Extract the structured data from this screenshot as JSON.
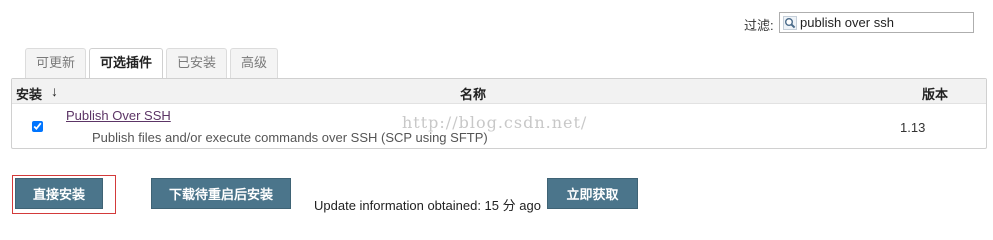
{
  "filter": {
    "label": "过滤:",
    "value": "publish over ssh"
  },
  "tabs": [
    {
      "label": "可更新",
      "active": false
    },
    {
      "label": "可选插件",
      "active": true
    },
    {
      "label": "已安装",
      "active": false
    },
    {
      "label": "高级",
      "active": false
    }
  ],
  "table": {
    "headers": {
      "install": "安装",
      "sort_indicator": "↓",
      "name": "名称",
      "version": "版本"
    },
    "rows": [
      {
        "checked": true,
        "name": "Publish Over SSH",
        "description": "Publish files and/or execute commands over SSH (SCP using SFTP)",
        "version": "1.13"
      }
    ]
  },
  "watermark": "http://blog.csdn.net/",
  "actions": {
    "install_now": "直接安装",
    "download_restart": "下载待重启后安装",
    "update_info": "Update information obtained: 15 分 ago",
    "fetch_now": "立即获取"
  },
  "colors": {
    "button_bg": "#4b758b",
    "link": "#5c3566",
    "highlight_frame": "#d33a3a"
  },
  "icons": {
    "filter": "search-icon"
  }
}
